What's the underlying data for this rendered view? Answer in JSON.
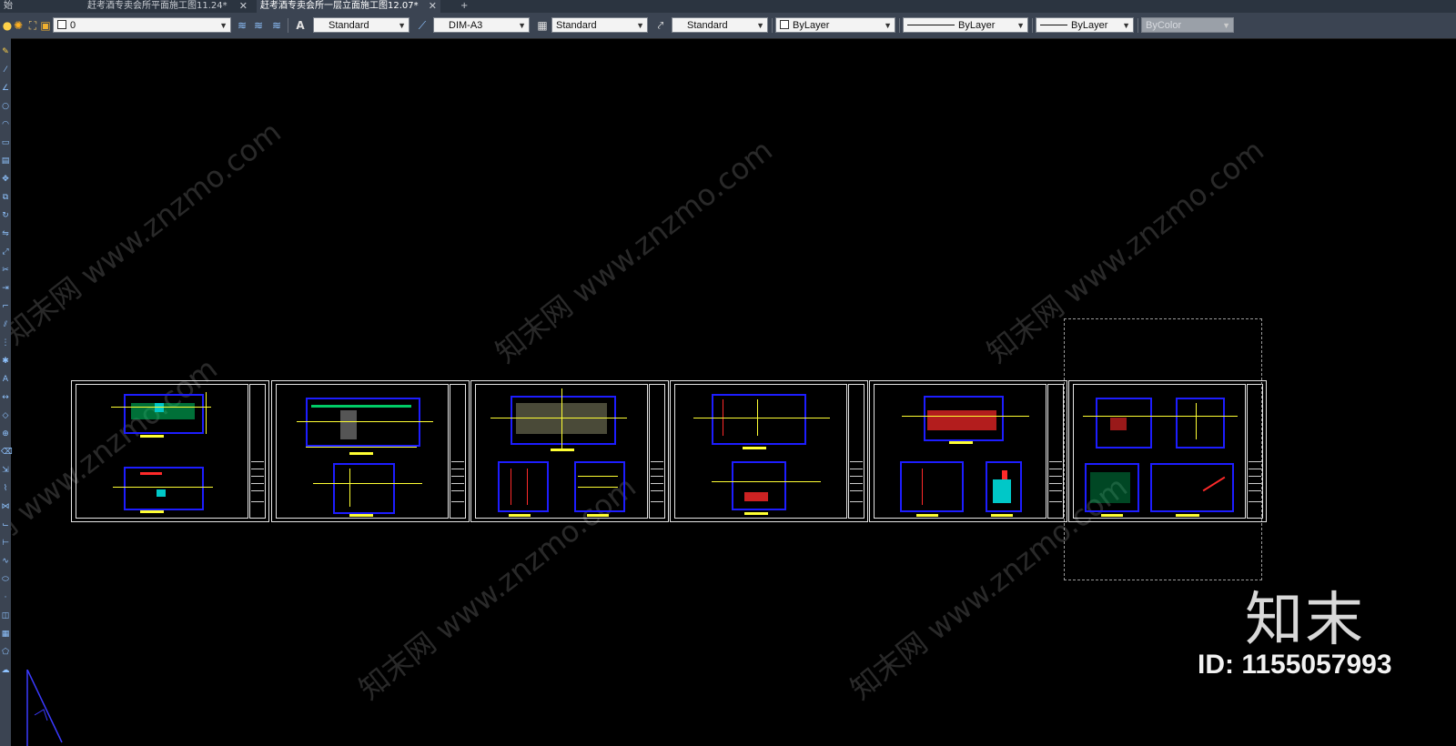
{
  "tabs": [
    {
      "label": "始",
      "active": false
    },
    {
      "label": "赶考酒专卖会所平面施工图11.24*",
      "active": false
    },
    {
      "label": "赶考酒专卖会所一层立面施工图12.07*",
      "active": true
    },
    {
      "label": "+",
      "active": false
    }
  ],
  "toolbar": {
    "layer_value": "0",
    "text_style": "Standard",
    "dim_style": "DIM-A3",
    "table_style": "Standard",
    "multileader_style": "Standard",
    "color": "ByLayer",
    "linetype": "ByLayer",
    "lineweight": "ByLayer",
    "plot_style": "ByColor"
  },
  "icons": {
    "layer_tools": [
      "lightbulb-icon",
      "sun-icon",
      "layer-freeze-icon",
      "lock-icon",
      "color-swatch-icon"
    ],
    "layer_props": [
      "layer-properties-icon",
      "layer-state-icon",
      "layer-match-icon"
    ],
    "text_style": "text-style-icon",
    "dim_style": "dimension-style-icon",
    "table_style": "table-style-icon",
    "multileader": "multileader-style-icon"
  },
  "canvas": {
    "background": "#000000",
    "sheet_count": 6,
    "watermark_text": "知末网 www.znzmo.com"
  },
  "brand": {
    "logo_text": "知末",
    "id_label": "ID: 1155057993"
  },
  "colors": {
    "tabbar": "#2b3440",
    "toolbar": "#3b4452",
    "viewport_border": "#1d1dff",
    "annotation": "#ffff33",
    "accent_green": "#00cc66",
    "accent_red": "#ff2a2a",
    "accent_cyan": "#00c8c8"
  }
}
